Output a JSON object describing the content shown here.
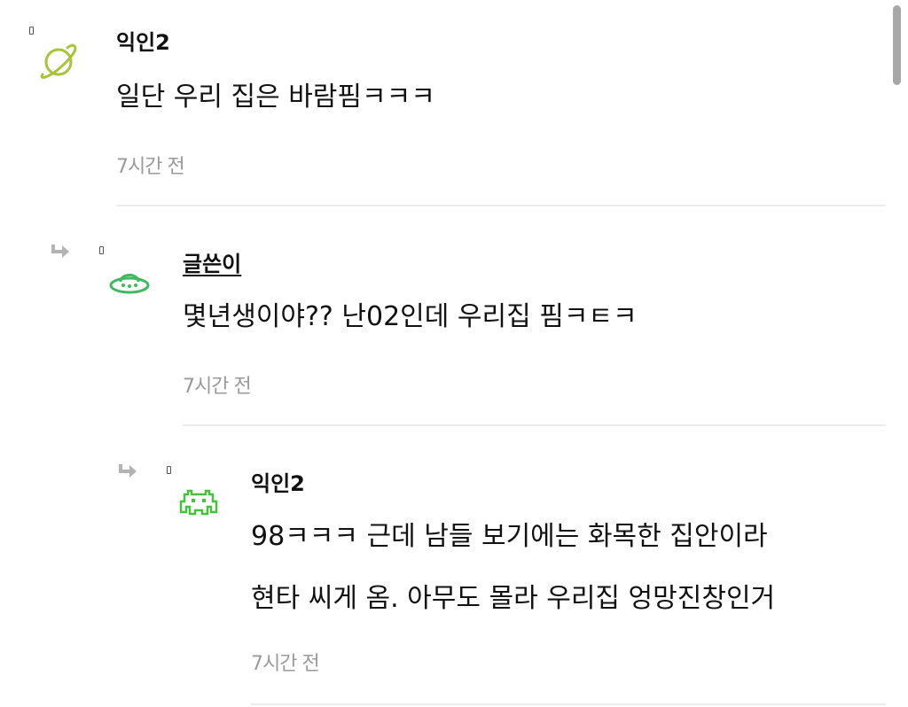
{
  "comments": [
    {
      "author": "익인2",
      "lines": [
        "일단 우리 집은 바람핌ㅋㅋㅋ"
      ],
      "time": "7시간 전",
      "avatar_icon": "planet-icon",
      "avatar_color": "#a8c23a"
    },
    {
      "author": "글쓴이",
      "lines": [
        "몇년생이야?? 난02인데 우리집 핌ㅋㅌㅋ"
      ],
      "time": "7시간 전",
      "avatar_icon": "ufo-icon",
      "avatar_color": "#3fb85f"
    },
    {
      "author": "익인2",
      "lines": [
        "98ㅋㅋㅋ 근데 남들 보기에는 화목한 집안이라",
        "현타 씨게 옴. 아무도 몰라 우리집 엉망진창인거"
      ],
      "time": "7시간 전",
      "avatar_icon": "space-invader-icon",
      "avatar_color": "#44c23a"
    }
  ],
  "colors": {
    "time_gray": "#9a9a9a",
    "divider": "#ececec",
    "reply_arrow": "#b3b3b3"
  }
}
